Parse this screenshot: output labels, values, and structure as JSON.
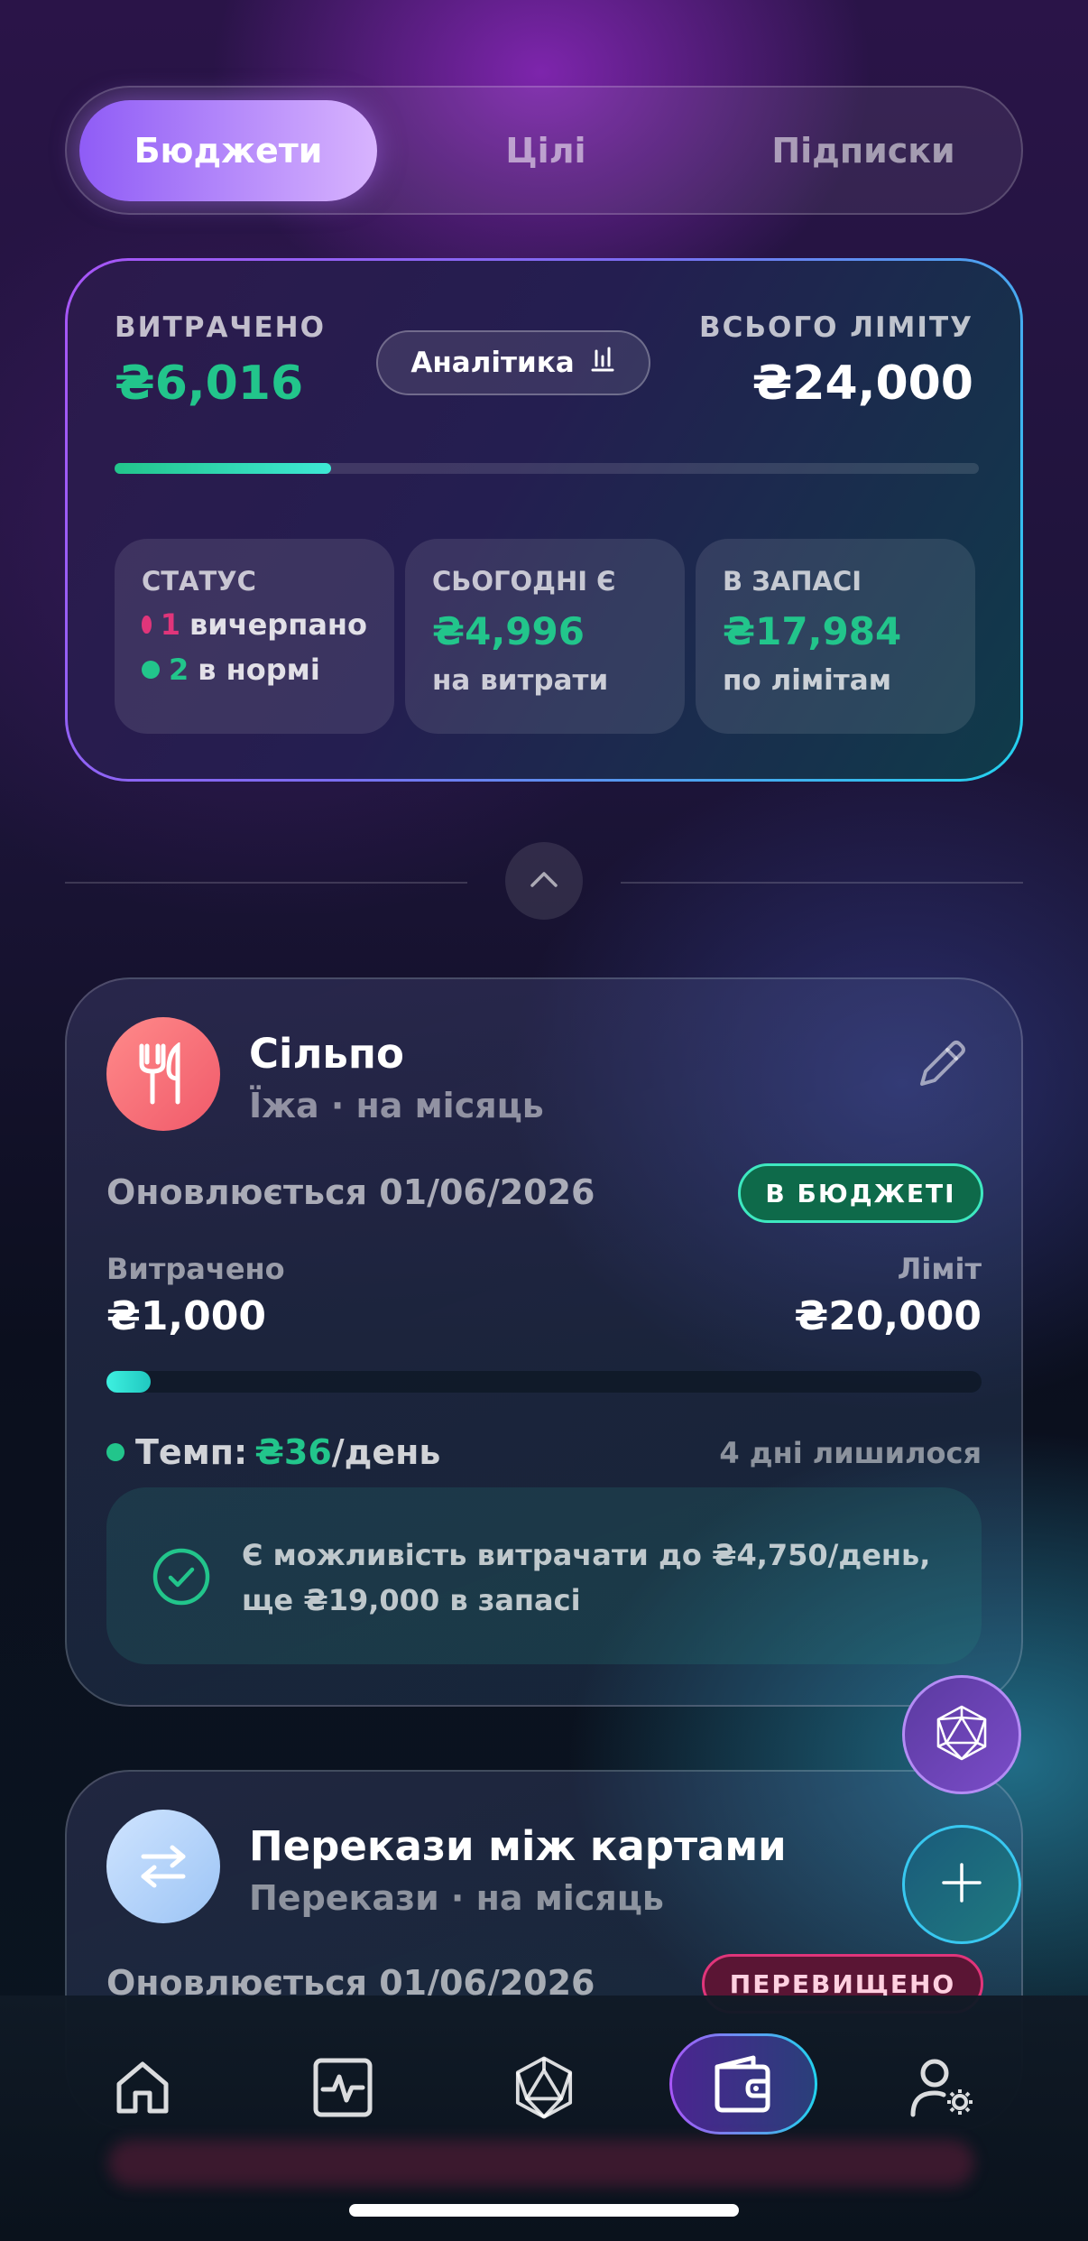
{
  "tabs": [
    {
      "label": "Бюджети",
      "active": true
    },
    {
      "label": "Цілі",
      "active": false
    },
    {
      "label": "Підписки",
      "active": false
    }
  ],
  "summary": {
    "spent_label": "ВИТРАЧЕНО",
    "spent_value": "₴6,016",
    "analytics_label": "Аналітика",
    "limit_label": "ВСЬОГО ЛІМІТУ",
    "limit_value": "₴24,000",
    "progress_fraction": 0.25,
    "status": {
      "label": "СТАТУС",
      "exhausted_count": "1",
      "exhausted_text": "вичерпано",
      "ok_count": "2",
      "ok_text": "в нормі"
    },
    "today": {
      "label": "СЬОГОДНІ Є",
      "value": "₴4,996",
      "sub": "на витрати"
    },
    "reserve": {
      "label": "В ЗАПАСІ",
      "value": "₴17,984",
      "sub": "по лімітам"
    }
  },
  "budgets": [
    {
      "name": "Сільпо",
      "subtitle": "Їжа · на місяць",
      "renews": "Оновлюється 01/06/2026",
      "badge": "В БЮДЖЕТІ",
      "spent_label": "Витрачено",
      "spent_value": "₴1,000",
      "limit_label": "Ліміт",
      "limit_value": "₴20,000",
      "progress_fraction": 0.05,
      "tempo_label": "Темп:",
      "tempo_value": "₴36",
      "tempo_unit": "/день",
      "days_left": "4 дні лишилося",
      "tip": "Є можливість витрачати до ₴4,750/день, ще ₴19,000 в запасі"
    },
    {
      "name": "Перекази між картами",
      "subtitle": "Перекази · на місяць",
      "renews": "Оновлюється 01/06/2026",
      "badge": "ПЕРЕВИЩЕНО"
    }
  ],
  "colors": {
    "accent_green": "#22c58b",
    "accent_purple": "#a855f7",
    "accent_cyan": "#22d3ee",
    "danger_pink": "#e0357a"
  },
  "nav": {
    "items": [
      "home-icon",
      "activity-icon",
      "ai-icon",
      "wallet-icon",
      "profile-settings-icon"
    ],
    "active": "wallet-icon"
  }
}
